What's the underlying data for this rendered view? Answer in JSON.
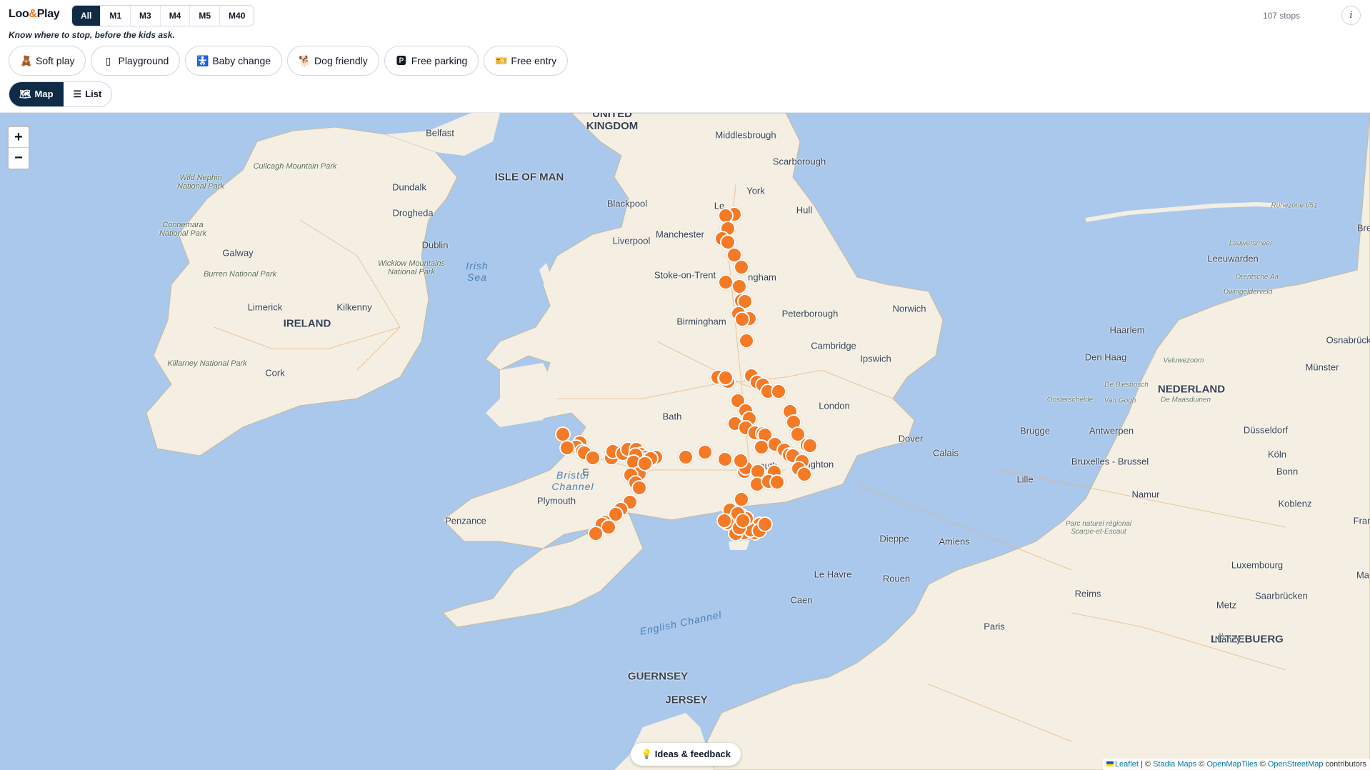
{
  "app": {
    "brand_pre": "Loo",
    "brand_amp": "&",
    "brand_post": "Play",
    "tagline": "Know where to stop, before the kids ask.",
    "stop_count": "107 stops",
    "info_label": "i"
  },
  "motorways": [
    "All",
    "M1",
    "M3",
    "M4",
    "M5",
    "M40"
  ],
  "motorway_selected": "All",
  "filters": [
    {
      "icon": "🧸",
      "icon_name": "teddy-icon",
      "label": "Soft play"
    },
    {
      "icon": "▯",
      "icon_name": "playground-icon",
      "label": "Playground"
    },
    {
      "icon": "🚼",
      "icon_name": "baby-change-icon",
      "label": "Baby change"
    },
    {
      "icon": "🐕",
      "icon_name": "dog-icon",
      "label": "Dog friendly"
    },
    {
      "icon": "🅿",
      "icon_name": "parking-icon",
      "label": "Free parking"
    },
    {
      "icon": "🎫",
      "icon_name": "ticket-icon",
      "label": "Free entry"
    }
  ],
  "views": [
    {
      "icon": "🗺",
      "label": "Map",
      "active": true
    },
    {
      "icon": "☰",
      "label": "List",
      "active": false
    }
  ],
  "map": {
    "zoom_in": "+",
    "zoom_out": "−",
    "feedback_label": "💡 Ideas & feedback",
    "attribution": {
      "leaflet": "Leaflet",
      "sep1": " | © ",
      "stadia": "Stadia Maps",
      "sep2": " © ",
      "omt": "OpenMapTiles",
      "sep3": " © ",
      "osm": "OpenStreetMap",
      "tail": " contributors"
    },
    "labels": {
      "united_kingdom": "UNITED\nKINGDOM",
      "isle_of_man": "ISLE OF MAN",
      "ireland": "IRELAND",
      "nederland": "NEDERLAND",
      "guernsey": "GUERNSEY",
      "jersey": "JERSEY",
      "letzebuerg": "LËTZEBUERG",
      "irish_sea": "Irish\nSea",
      "bristol_channel": "Bristol\nChannel",
      "english_channel": "English Channel",
      "belfast": "Belfast",
      "dundalk": "Dundalk",
      "drogheda": "Drogheda",
      "dublin": "Dublin",
      "galway": "Galway",
      "limerick": "Limerick",
      "kilkenny": "Kilkenny",
      "cork": "Cork",
      "middlesbrough": "Middlesbrough",
      "scarborough": "Scarborough",
      "york": "York",
      "hull": "Hull",
      "blackpool": "Blackpool",
      "leeds": "Le",
      "manchester": "Manchester",
      "liverpool": "Liverpool",
      "stoke": "Stoke-on-Trent",
      "nottingham": "ngham",
      "norwich": "Norwich",
      "peterborough": "Peterborough",
      "birmingham": "Birmingham",
      "cambridge": "Cambridge",
      "ipswich": "Ipswich",
      "london": "London",
      "bath": "Bath",
      "dover": "Dover",
      "brighton": "Brighton",
      "southampton": "outh",
      "plymouth": "Plymouth",
      "penzance": "Penzance",
      "exeter": "E",
      "calais": "Calais",
      "lille": "Lille",
      "brugge": "Brugge",
      "antwerpen": "Antwerpen",
      "bruxelles": "Bruxelles - Brussel",
      "namur": "Namur",
      "dieppe": "Dieppe",
      "amiens": "Amiens",
      "le_havre": "Le Havre",
      "rouen": "Rouen",
      "caen": "Caen",
      "paris": "Paris",
      "reims": "Reims",
      "metz": "Metz",
      "nancy": "Nancy",
      "haarlem": "Haarlem",
      "den_haag": "Den Haag",
      "leeuwarden": "Leeuwarden",
      "osnabruck": "Osnabrück",
      "munster": "Münster",
      "dusseldorf": "Düsseldorf",
      "koln": "Köln",
      "bonn": "Bonn",
      "koblenz": "Koblenz",
      "luxembourg": "Luxembourg",
      "saarbrucken": "Saarbrücken",
      "bremen": "Bre",
      "fra": "Fran",
      "ma": "Ma",
      "wild_nephin": "Wild Nephin\nNational Park",
      "connemara": "Connemara\nNational Park",
      "burren": "Burren National Park",
      "killarney": "Killarney National Park",
      "wicklow": "Wicklow Mountains\nNational Park",
      "cuilcagh": "Cuilcagh Mountain Park",
      "lauwersmeer": "Lauwersmeer",
      "drentsche": "Drentsche Aa",
      "dwingelderveld": "Dwingelderveld",
      "veluwezoom": "Veluwezoom",
      "biesbosch": "De Biesbosch",
      "oosterschelde": "Oosterschelde",
      "van_gogh": "Van Gogh",
      "maasduinen": "De Maasduinen",
      "scarpe": "Parc naturel régional\nScarpe-et-Escaut",
      "ruhezone": "Ruhezone I/51"
    }
  },
  "markers_count": 107
}
